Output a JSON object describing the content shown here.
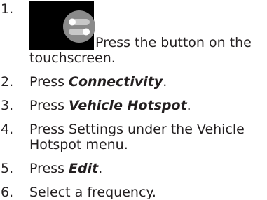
{
  "steps": [
    {
      "number": "1.",
      "line1": "Press the button on the",
      "line2": "touchscreen.",
      "icon": "settings-toggle-icon"
    },
    {
      "number": "2.",
      "prefix": "Press ",
      "emphasis": "Connectivity",
      "suffix": "."
    },
    {
      "number": "3.",
      "prefix": "Press ",
      "emphasis": "Vehicle Hotspot",
      "suffix": "."
    },
    {
      "number": "4.",
      "line1": "Press Settings under the Vehicle",
      "line2": "Hotspot menu."
    },
    {
      "number": "5.",
      "prefix": "Press ",
      "emphasis": "Edit",
      "suffix": "."
    },
    {
      "number": "6.",
      "text": "Select a frequency."
    }
  ],
  "colors": {
    "text": "#231f20",
    "icon_background": "#000000",
    "icon_circle": "#8a8a8a"
  }
}
